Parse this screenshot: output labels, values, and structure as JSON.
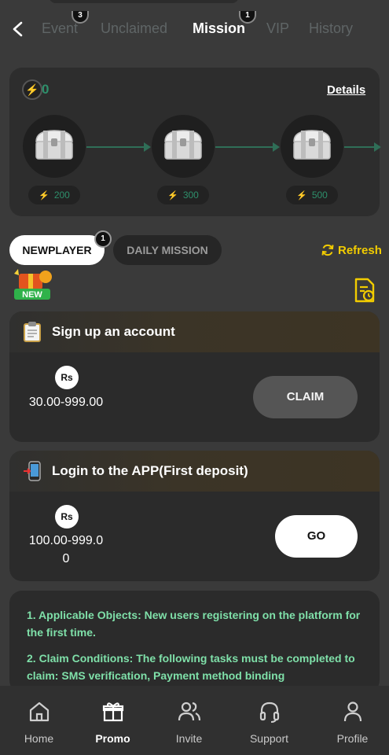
{
  "tabs": [
    {
      "label": "Event",
      "badge": "3"
    },
    {
      "label": "Unclaimed",
      "badge": ""
    },
    {
      "label": "Mission",
      "badge": "1"
    },
    {
      "label": "VIP",
      "badge": ""
    },
    {
      "label": "History",
      "badge": ""
    }
  ],
  "active_tab": "Mission",
  "rewards": {
    "points": "0",
    "details_label": "Details",
    "chests": [
      {
        "value": "200"
      },
      {
        "value": "300"
      },
      {
        "value": "500"
      }
    ]
  },
  "subtabs": {
    "newplayer": "NEWPLAYER",
    "newplayer_badge": "1",
    "daily": "DAILY MISSION",
    "refresh": "Refresh"
  },
  "new_badge_text": "NEW",
  "tasks": [
    {
      "title": "Sign up an account",
      "currency": "Rs",
      "amount": "30.00-999.00",
      "button": "CLAIM"
    },
    {
      "title": "Login to the APP(First deposit)",
      "currency": "Rs",
      "amount": "100.00-999.00",
      "button": "GO"
    }
  ],
  "rules": [
    "1. Applicable Objects: New users registering on the platform for the first time.",
    "2. Claim Conditions: The following tasks must be completed to claim: SMS verification, Payment method binding"
  ],
  "nav": [
    {
      "label": "Home",
      "icon": "home-icon"
    },
    {
      "label": "Promo",
      "icon": "gift-icon"
    },
    {
      "label": "Invite",
      "icon": "users-icon"
    },
    {
      "label": "Support",
      "icon": "headset-icon"
    },
    {
      "label": "Profile",
      "icon": "person-icon"
    }
  ],
  "colors": {
    "accent_green": "#2e8f6b",
    "bolt": "#e6c200",
    "refresh": "#f2cc00",
    "rules_text": "#7fe0a9"
  }
}
